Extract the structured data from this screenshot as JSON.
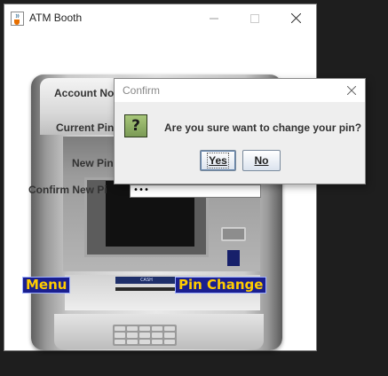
{
  "window": {
    "title": "ATM Booth",
    "icons": [
      "java-cup-icon",
      "minimize-icon",
      "maximize-icon",
      "close-icon"
    ]
  },
  "atm": {
    "cash_slot_label": "CASH",
    "labels": {
      "account_no": "Account No",
      "current_pin": "Current Pin",
      "new_pin": "New Pin",
      "confirm_new_pin": "Confirm New Pi"
    },
    "confirm_pin_value": "•••",
    "menu_button": "Menu",
    "pin_change_button": "Pin Change"
  },
  "dialog": {
    "title": "Confirm",
    "icon": "question-icon",
    "icon_glyph": "?",
    "message": "Are you sure want to change your pin?",
    "yes_label": "Yes",
    "no_label": "No"
  },
  "colors": {
    "atm_button_text": "#ffcc00",
    "atm_button_bg": "#1a1f8f",
    "question_icon": "#8fb065"
  }
}
